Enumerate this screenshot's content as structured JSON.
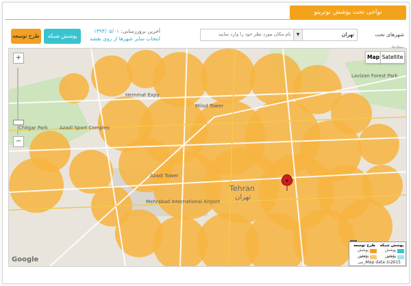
{
  "header": {
    "title": "نواحی تحت پوشش نوترینو"
  },
  "controls": {
    "dev_plan_label": "طرح توسعه",
    "coverage_label": "پوشش شبکه",
    "update_label": "آخرین بروزرسانی:",
    "update_date": "۱۳۹۴/۰۵/۰۱",
    "other_cities_link": "انتخاب سایر شهرها از روی نقشه",
    "search_placeholder": "نام مکان مورد نظر خود را وارد نمایید",
    "city_value": "تهران",
    "city_label": "شهرهای تحت پوشش"
  },
  "map": {
    "type_map": "Map",
    "type_satellite": "Satellite",
    "zoom_in": "+",
    "zoom_out": "−",
    "google_logo": "Google",
    "attribution": "Map data ©2015",
    "labels": {
      "tehran_en": "Tehran",
      "tehran_fa": "تهران",
      "hemmat": "Hemmat Expy",
      "milad": "Milad Tower",
      "azadi": "Azadi Tower",
      "mehrabad": "Mehrabad International Airport",
      "chitgar": "Chitgar Park",
      "lavizan": "Lavizan Forest Park",
      "azadi_sport": "Azadi Sport Complex"
    },
    "colors": {
      "coverage": "#f7b43f",
      "development": "#f39c2c",
      "marker": "#cc1f1f"
    }
  },
  "legend": {
    "network_header": "پوشش شبکه",
    "network_inner": "پوشش داخلی",
    "network_outer": "پوشش خارجی",
    "dev_header": "طرح توسعه",
    "dev_inner": "پوشش داخلی",
    "dev_outer": "پوشش خارجی",
    "close": "X"
  }
}
